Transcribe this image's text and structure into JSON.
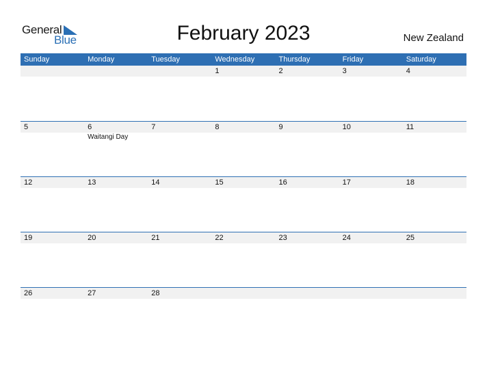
{
  "logo": {
    "line1": "General",
    "line2": "Blue"
  },
  "title": "February 2023",
  "country": "New Zealand",
  "colors": {
    "accent": "#2e6fb3",
    "row_bg": "#f1f1f1"
  },
  "weekdays": [
    "Sunday",
    "Monday",
    "Tuesday",
    "Wednesday",
    "Thursday",
    "Friday",
    "Saturday"
  ],
  "weeks": [
    {
      "days": [
        "",
        "",
        "",
        "1",
        "2",
        "3",
        "4"
      ],
      "events": [
        "",
        "",
        "",
        "",
        "",
        "",
        ""
      ]
    },
    {
      "days": [
        "5",
        "6",
        "7",
        "8",
        "9",
        "10",
        "11"
      ],
      "events": [
        "",
        "Waitangi Day",
        "",
        "",
        "",
        "",
        ""
      ]
    },
    {
      "days": [
        "12",
        "13",
        "14",
        "15",
        "16",
        "17",
        "18"
      ],
      "events": [
        "",
        "",
        "",
        "",
        "",
        "",
        ""
      ]
    },
    {
      "days": [
        "19",
        "20",
        "21",
        "22",
        "23",
        "24",
        "25"
      ],
      "events": [
        "",
        "",
        "",
        "",
        "",
        "",
        ""
      ]
    },
    {
      "days": [
        "26",
        "27",
        "28",
        "",
        "",
        "",
        ""
      ],
      "events": [
        "",
        "",
        "",
        "",
        "",
        "",
        ""
      ]
    }
  ]
}
